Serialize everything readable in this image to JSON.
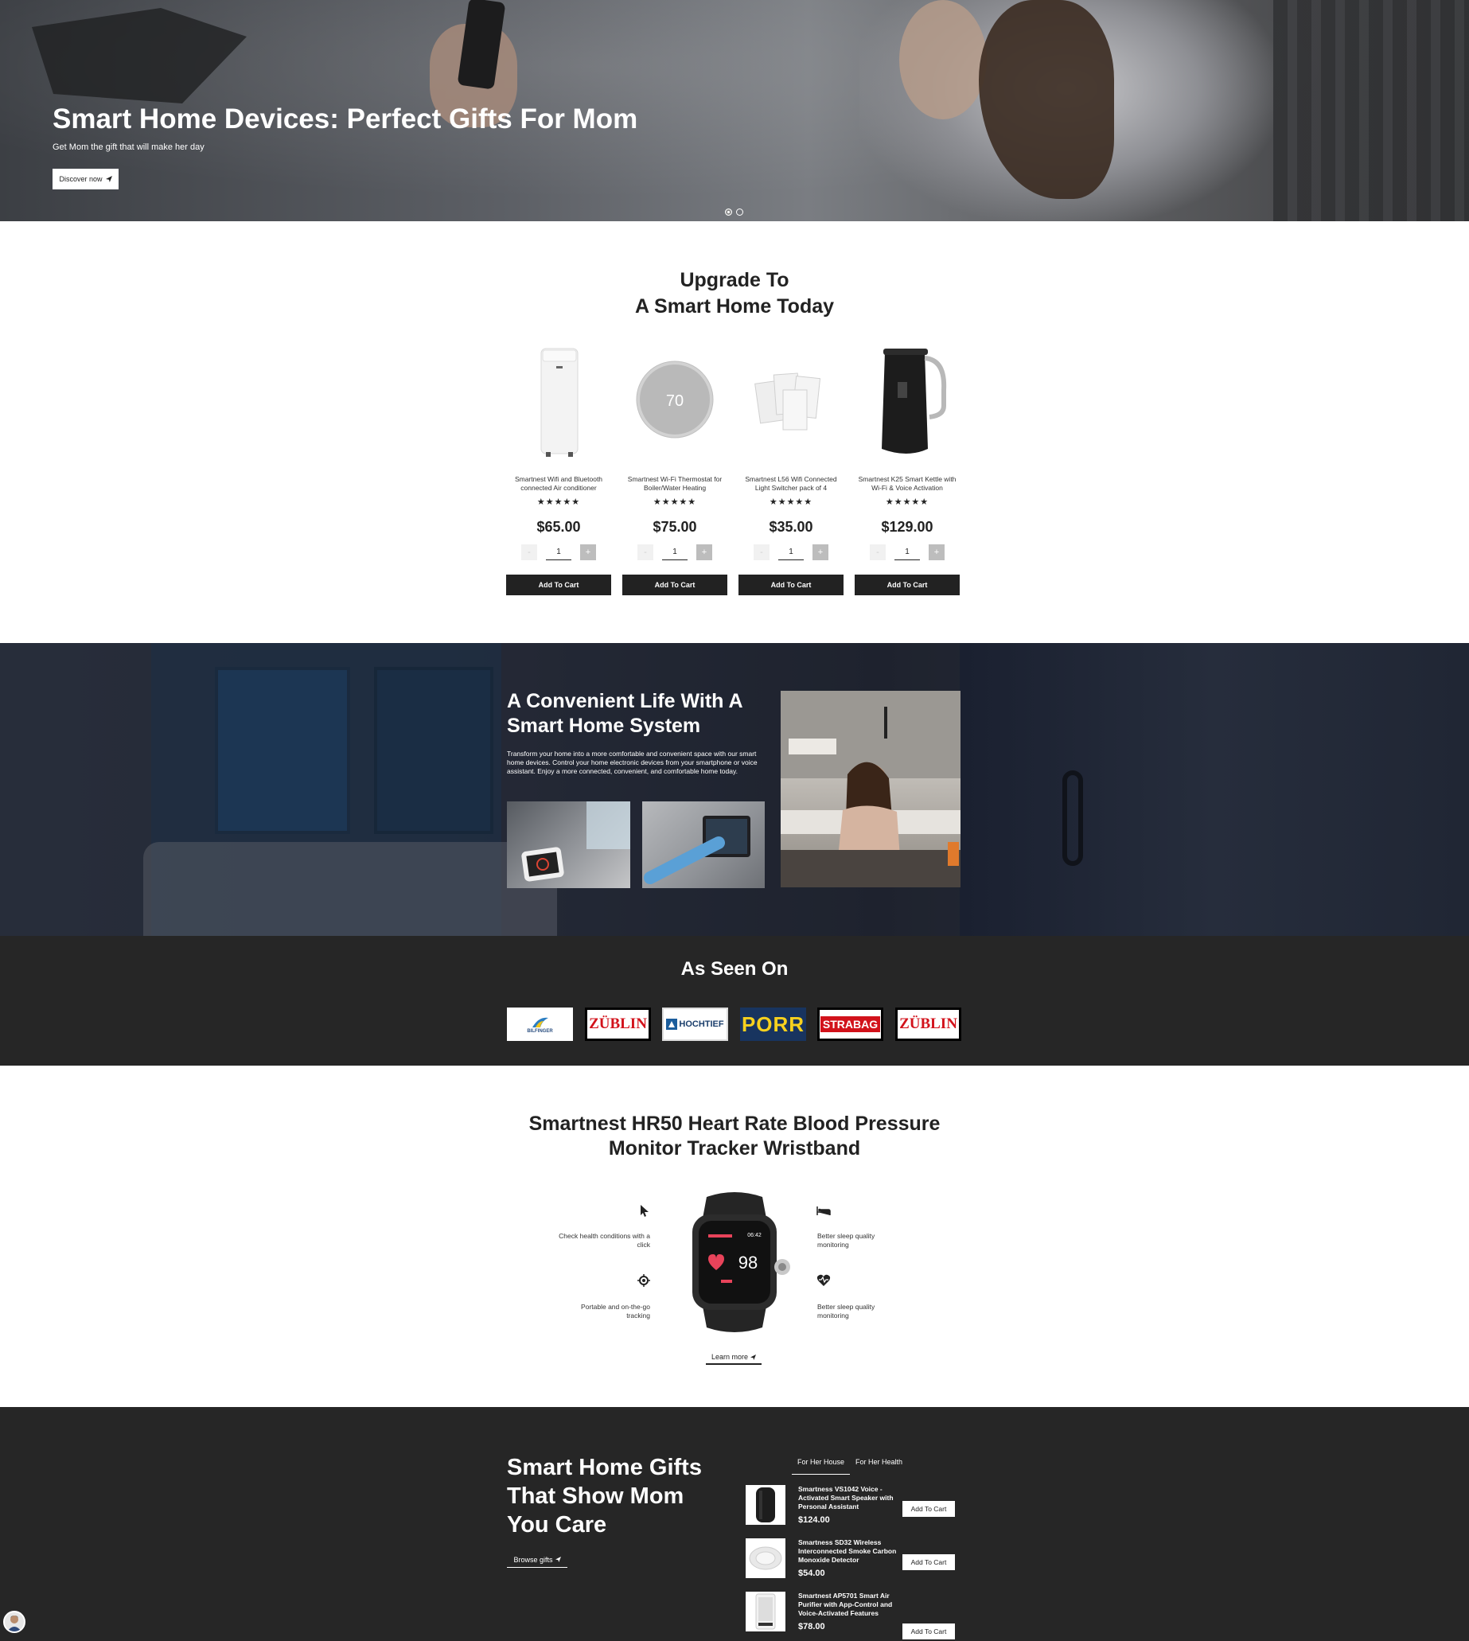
{
  "hero": {
    "title": "Smart Home Devices: Perfect Gifts For Mom",
    "subtitle": "Get Mom the gift that will make her day",
    "button_label": "Discover now",
    "button_icon": "paper-plane-icon",
    "slides": 2,
    "active_slide": 1
  },
  "upgrade": {
    "title_line1": "Upgrade To",
    "title_line2": "A Smart Home Today",
    "products": [
      {
        "name": "Smartnest Wifi and Bluetooth connected Air conditioner",
        "rating": "★★★★★",
        "price": "$65.00",
        "qty": "1",
        "cart_label": "Add To Cart"
      },
      {
        "name": "Smartnest Wi-Fi Thermostat for Boiler/Water Heating",
        "rating": "★★★★★",
        "price": "$75.00",
        "qty": "1",
        "cart_label": "Add To Cart",
        "display_value": "70"
      },
      {
        "name": "Smartnest L56 Wifi Connected Light Switcher pack of 4",
        "rating": "★★★★★",
        "price": "$35.00",
        "qty": "1",
        "cart_label": "Add To Cart"
      },
      {
        "name": "Smartnest K25 Smart Kettle with Wi-Fi & Voice Activation",
        "rating": "★★★★★",
        "price": "$129.00",
        "qty": "1",
        "cart_label": "Add To Cart"
      }
    ],
    "minus": "-",
    "plus": "+"
  },
  "convenient": {
    "title": "A Convenient Life With A Smart Home System",
    "text": "Transform your home into a more comfortable and convenient space with our smart home devices. Control your home electronic devices from your smartphone or voice assistant. Enjoy a more connected, convenient, and comfortable home today."
  },
  "seen_on": {
    "title": "As Seen On",
    "logos": [
      "BILFINGER",
      "ZÜBLIN",
      "HOCHTIEF",
      "PORR",
      "STRABAG",
      "ZÜBLIN"
    ]
  },
  "watch": {
    "title_line1": "Smartnest HR50 Heart Rate Blood Pressure",
    "title_line2": "Monitor Tracker Wristband",
    "features": {
      "left_top": "Check health conditions with a click",
      "left_bottom": "Portable and on-the-go tracking",
      "right_top": "Better sleep quality monitoring",
      "right_bottom": "Better sleep quality monitoring"
    },
    "screen_value": "98",
    "screen_time": "06:42",
    "learn_label": "Learn more"
  },
  "gifts": {
    "title": "Smart Home Gifts That Show Mom You Care",
    "browse_label": "Browse gifts",
    "tabs": [
      "For Her House",
      "For Her Health"
    ],
    "items": [
      {
        "name": "Smartness VS1042 Voice - Activated Smart Speaker with Personal Assistant",
        "price": "$124.00",
        "cart_label": "Add To Cart"
      },
      {
        "name": "Smartness SD32 Wireless Interconnected Smoke Carbon Monoxide Detector",
        "price": "$54.00",
        "cart_label": "Add To Cart"
      },
      {
        "name": "Smartnest AP5701 Smart Air Purifier with App-Control and Voice-Activated Features",
        "price": "$78.00",
        "cart_label": "Add To Cart"
      }
    ]
  }
}
